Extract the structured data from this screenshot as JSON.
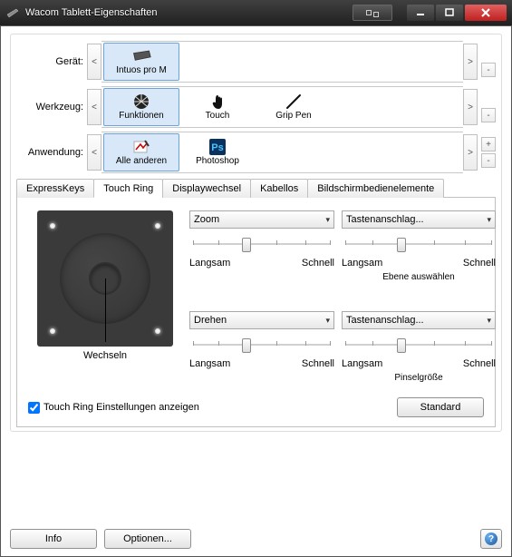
{
  "window": {
    "title": "Wacom Tablett-Eigenschaften"
  },
  "rows": {
    "device": {
      "label": "Gerät:",
      "items": [
        {
          "label": "Intuos pro M"
        }
      ]
    },
    "tool": {
      "label": "Werkzeug:",
      "items": [
        {
          "label": "Funktionen"
        },
        {
          "label": "Touch"
        },
        {
          "label": "Grip Pen"
        }
      ]
    },
    "app": {
      "label": "Anwendung:",
      "items": [
        {
          "label": "Alle anderen"
        },
        {
          "label": "Photoshop"
        }
      ]
    }
  },
  "nav": {
    "prev": "<",
    "next": ">",
    "plus": "+",
    "minus": "-"
  },
  "tabs": [
    "ExpressKeys",
    "Touch Ring",
    "Displaywechsel",
    "Kabellos",
    "Bildschirmbedienelemente"
  ],
  "activeTab": 1,
  "touchring": {
    "tl": {
      "select": "Zoom",
      "slow": "Langsam",
      "fast": "Schnell",
      "extra": ""
    },
    "tr": {
      "select": "Tastenanschlag...",
      "slow": "Langsam",
      "fast": "Schnell",
      "extra": "Ebene auswählen"
    },
    "bl": {
      "select": "Drehen",
      "slow": "Langsam",
      "fast": "Schnell",
      "extra": ""
    },
    "br": {
      "select": "Tastenanschlag...",
      "slow": "Langsam",
      "fast": "Schnell",
      "extra": "Pinselgröße"
    },
    "center": "Wechseln",
    "checkbox": "Touch Ring Einstellungen anzeigen",
    "standard": "Standard"
  },
  "footer": {
    "info": "Info",
    "options": "Optionen..."
  }
}
